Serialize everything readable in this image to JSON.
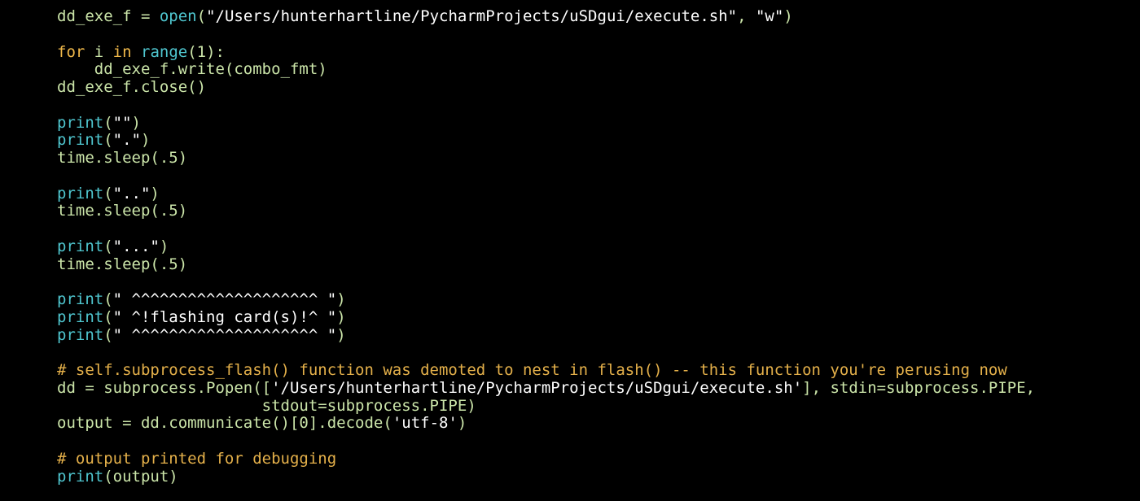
{
  "colors": {
    "background": "#000000",
    "plain": "#cbe5a9",
    "keyword": "#f0b84a",
    "builtin": "#4fc6cf",
    "string": "#ffffff",
    "comment": "#e4b04a"
  },
  "lines": [
    [
      {
        "t": "dd_exe_f = ",
        "c": "pl"
      },
      {
        "t": "open",
        "c": "bi"
      },
      {
        "t": "(",
        "c": "pl"
      },
      {
        "t": "\"/Users/hunterhartline/PycharmProjects/uSDgui/execute.sh\"",
        "c": "st"
      },
      {
        "t": ", ",
        "c": "pl"
      },
      {
        "t": "\"w\"",
        "c": "st"
      },
      {
        "t": ")",
        "c": "pl"
      }
    ],
    [],
    [
      {
        "t": "for",
        "c": "kw"
      },
      {
        "t": " i ",
        "c": "pl"
      },
      {
        "t": "in",
        "c": "kw"
      },
      {
        "t": " ",
        "c": "pl"
      },
      {
        "t": "range",
        "c": "bi"
      },
      {
        "t": "(1):",
        "c": "pl"
      }
    ],
    [
      {
        "t": "    dd_exe_f.write(combo_fmt)",
        "c": "pl"
      }
    ],
    [
      {
        "t": "dd_exe_f.close()",
        "c": "pl"
      }
    ],
    [],
    [
      {
        "t": "print",
        "c": "bi"
      },
      {
        "t": "(",
        "c": "pl"
      },
      {
        "t": "\"\"",
        "c": "st"
      },
      {
        "t": ")",
        "c": "pl"
      }
    ],
    [
      {
        "t": "print",
        "c": "bi"
      },
      {
        "t": "(",
        "c": "pl"
      },
      {
        "t": "\".\"",
        "c": "st"
      },
      {
        "t": ")",
        "c": "pl"
      }
    ],
    [
      {
        "t": "time.sleep(.5)",
        "c": "pl"
      }
    ],
    [],
    [
      {
        "t": "print",
        "c": "bi"
      },
      {
        "t": "(",
        "c": "pl"
      },
      {
        "t": "\"..\"",
        "c": "st"
      },
      {
        "t": ")",
        "c": "pl"
      }
    ],
    [
      {
        "t": "time.sleep(.5)",
        "c": "pl"
      }
    ],
    [],
    [
      {
        "t": "print",
        "c": "bi"
      },
      {
        "t": "(",
        "c": "pl"
      },
      {
        "t": "\"...\"",
        "c": "st"
      },
      {
        "t": ")",
        "c": "pl"
      }
    ],
    [
      {
        "t": "time.sleep(.5)",
        "c": "pl"
      }
    ],
    [],
    [
      {
        "t": "print",
        "c": "bi"
      },
      {
        "t": "(",
        "c": "pl"
      },
      {
        "t": "\" ^^^^^^^^^^^^^^^^^^^^ \"",
        "c": "st"
      },
      {
        "t": ")",
        "c": "pl"
      }
    ],
    [
      {
        "t": "print",
        "c": "bi"
      },
      {
        "t": "(",
        "c": "pl"
      },
      {
        "t": "\" ^!flashing card(s)!^ \"",
        "c": "st"
      },
      {
        "t": ")",
        "c": "pl"
      }
    ],
    [
      {
        "t": "print",
        "c": "bi"
      },
      {
        "t": "(",
        "c": "pl"
      },
      {
        "t": "\" ^^^^^^^^^^^^^^^^^^^^ \"",
        "c": "st"
      },
      {
        "t": ")",
        "c": "pl"
      }
    ],
    [],
    [
      {
        "t": "# self.subprocess_flash() function was demoted to nest in flash() -- this function you're perusing now",
        "c": "cm"
      }
    ],
    [
      {
        "t": "dd = subprocess.Popen([",
        "c": "pl"
      },
      {
        "t": "'/Users/hunterhartline/PycharmProjects/uSDgui/execute.sh'",
        "c": "st"
      },
      {
        "t": "], stdin=subprocess.PIPE,",
        "c": "pl"
      }
    ],
    [
      {
        "t": "                      stdout=subprocess.PIPE)",
        "c": "pl"
      }
    ],
    [
      {
        "t": "output = dd.communicate()[0].decode(",
        "c": "pl"
      },
      {
        "t": "'utf-8'",
        "c": "st"
      },
      {
        "t": ")",
        "c": "pl"
      }
    ],
    [],
    [
      {
        "t": "# output printed for debugging",
        "c": "cm"
      }
    ],
    [
      {
        "t": "print",
        "c": "bi"
      },
      {
        "t": "(output)",
        "c": "pl"
      }
    ]
  ]
}
